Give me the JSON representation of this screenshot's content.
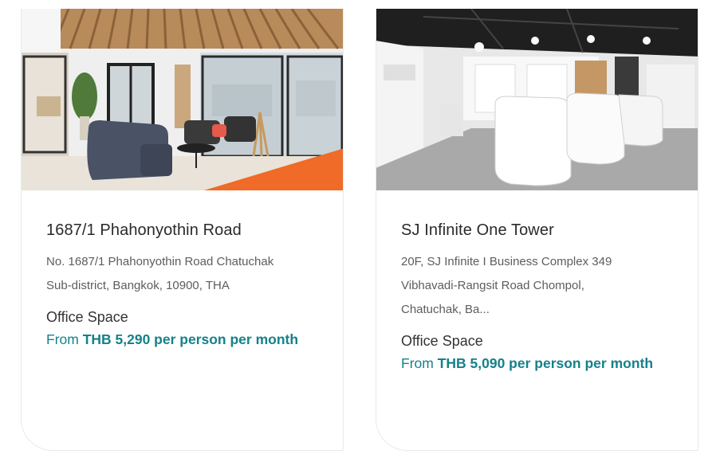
{
  "listings": [
    {
      "photo_alt": "Lounge with sofas and glass-walled offices",
      "title": "1687/1 Phahonyothin Road",
      "address_line1": "No. 1687/1 Phahonyothin Road Chatuchak",
      "address_line2": "Sub-district, Bangkok, 10900, THA",
      "address_line3": "",
      "product_type": "Office Space",
      "price_prefix": "From",
      "price_value": "THB 5,290 per person per month"
    },
    {
      "photo_alt": "Open coworking area with white desk pods",
      "title": "SJ Infinite One Tower",
      "address_line1": "20F, SJ Infinite I Business Complex 349",
      "address_line2": "Vibhavadi-Rangsit Road Chompol,",
      "address_line3": "Chatuchak, Ba...",
      "product_type": "Office Space",
      "price_prefix": "From",
      "price_value": "THB 5,090 per person per month"
    }
  ],
  "colors": {
    "price": "#15818a",
    "title": "#2a2a2a",
    "address": "#5d5d5d",
    "border": "#e9e9e9"
  }
}
